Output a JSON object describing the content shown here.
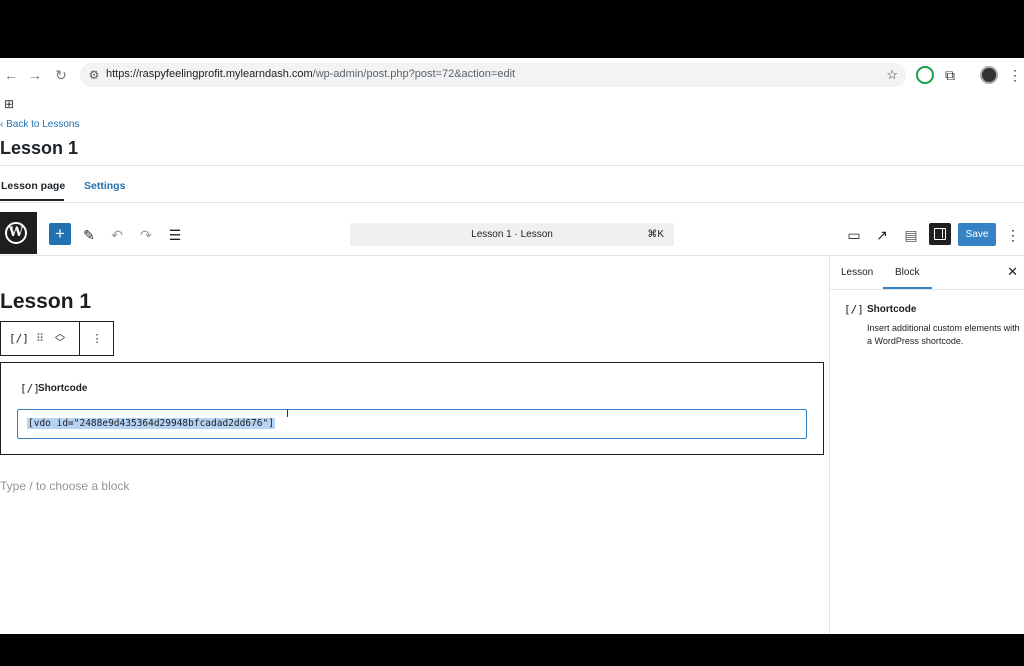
{
  "browser": {
    "url_host": "https://raspyfeelingprofit.mylearndash.com",
    "url_path": "/wp-admin/post.php?post=72&action=edit",
    "icons": [
      "back-icon",
      "forward-icon",
      "reload-icon",
      "site-settings-icon",
      "bookmark-star-icon",
      "extension-icon",
      "extensions-puzzle-icon",
      "profile-avatar-icon",
      "menu-kebab-icon",
      "apps-grid-icon"
    ]
  },
  "admin": {
    "back_link": "Back to Lessons",
    "heading": "Lesson 1",
    "tabs": [
      {
        "label": "Lesson page",
        "active": true
      },
      {
        "label": "Settings",
        "active": false
      }
    ]
  },
  "toolbar": {
    "document_title": "Lesson 1 · Lesson",
    "shortcut": "⌘K",
    "save_label": "Save",
    "accent": "#3582c4"
  },
  "editor": {
    "post_title": "Lesson 1",
    "block_icon": "[/]",
    "block_label": "Shortcode",
    "shortcode_value": "[vdo id=\"2488e9d435364d29948bfcadad2dd676\"]",
    "appender_placeholder": "Type / to choose a block"
  },
  "sidebar": {
    "tabs": [
      {
        "label": "Lesson",
        "active": false
      },
      {
        "label": "Block",
        "active": true
      }
    ],
    "block_icon": "[/]",
    "block_title": "Shortcode",
    "block_description": "Insert additional custom elements with a WordPress shortcode."
  }
}
